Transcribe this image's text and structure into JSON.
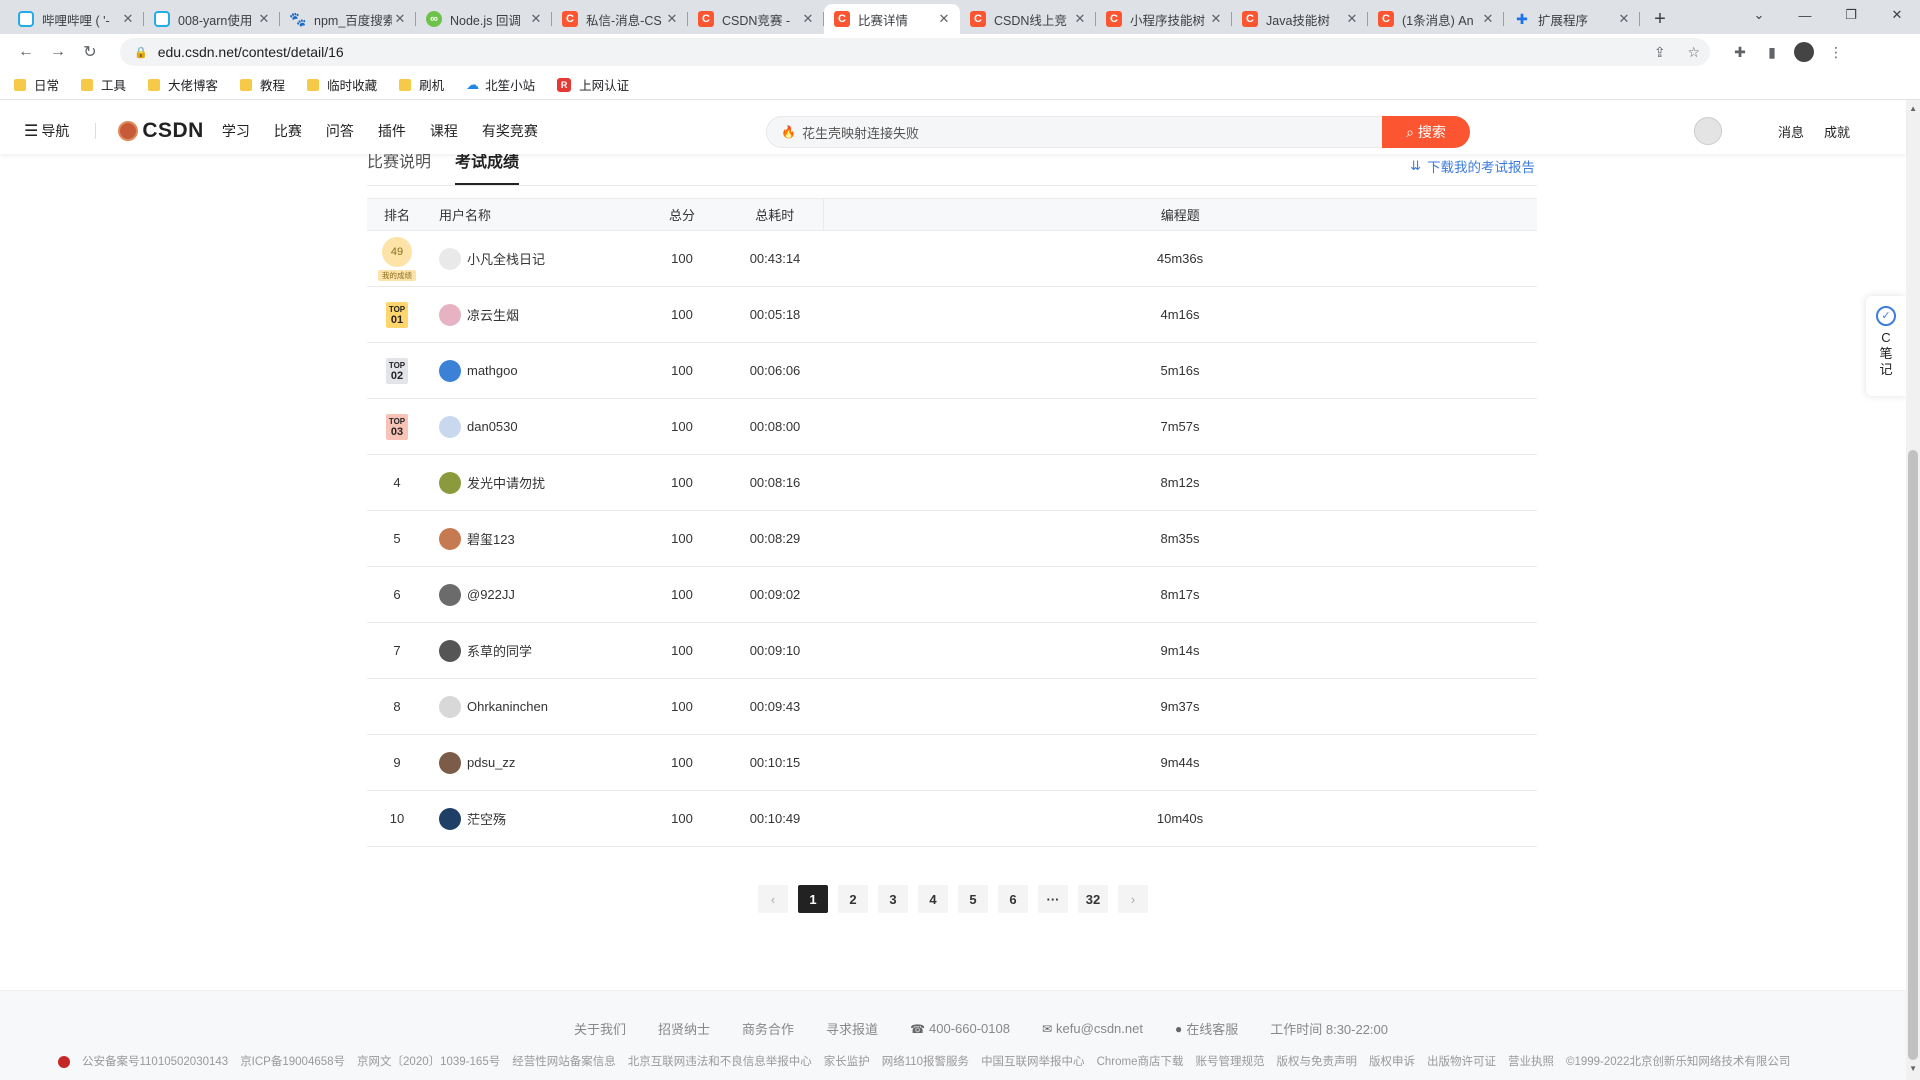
{
  "browser": {
    "tabs": [
      {
        "title": "哔哩哔哩 ( '-",
        "icon": "bili"
      },
      {
        "title": "008-yarn使用",
        "icon": "bili"
      },
      {
        "title": "npm_百度搜索",
        "icon": "paw"
      },
      {
        "title": "Node.js 回调",
        "icon": "node"
      },
      {
        "title": "私信-消息-CS",
        "icon": "csdn"
      },
      {
        "title": "CSDN竞赛 -",
        "icon": "csdn"
      },
      {
        "title": "比赛详情",
        "icon": "csdn"
      },
      {
        "title": "CSDN线上竞",
        "icon": "csdn"
      },
      {
        "title": "小程序技能树",
        "icon": "csdn"
      },
      {
        "title": "Java技能树",
        "icon": "csdn"
      },
      {
        "title": "(1条消息) An",
        "icon": "csdn"
      },
      {
        "title": "扩展程序",
        "icon": "puzzle"
      }
    ],
    "url": "edu.csdn.net/contest/detail/16",
    "bookmarks": [
      "日常",
      "工具",
      "大佬博客",
      "教程",
      "临时收藏",
      "刷机",
      "北笙小站",
      "上网认证"
    ]
  },
  "header": {
    "nav": "导航",
    "logo": "CSDN",
    "links": [
      "学习",
      "比赛",
      "问答",
      "插件",
      "课程",
      "有奖竞赛"
    ],
    "search_placeholder": "花生壳映射连接失败",
    "search_btn": "搜索",
    "messages": "消息",
    "achievements": "成就"
  },
  "content": {
    "tabs": [
      "比赛说明",
      "考试成绩"
    ],
    "active_tab": 1,
    "download": "下载我的考试报告",
    "columns": [
      "排名",
      "用户名称",
      "总分",
      "总耗时",
      "编程题"
    ],
    "mine_label": "我的成绩",
    "top_label": "TOP",
    "rows": [
      {
        "rank": "49",
        "badge": "mine",
        "name": "小凡全栈日记",
        "score": "100",
        "time": "00:43:14",
        "prog": "45m36s",
        "avatar": "#e9e9e9"
      },
      {
        "rank": "01",
        "badge": "gold",
        "name": "凉云生烟",
        "score": "100",
        "time": "00:05:18",
        "prog": "4m16s",
        "avatar": "#e7b3c3"
      },
      {
        "rank": "02",
        "badge": "silver",
        "name": "mathgoo",
        "score": "100",
        "time": "00:06:06",
        "prog": "5m16s",
        "avatar": "#3b82d6"
      },
      {
        "rank": "03",
        "badge": "bronze",
        "name": "dan0530",
        "score": "100",
        "time": "00:08:00",
        "prog": "7m57s",
        "avatar": "#c9d8ef"
      },
      {
        "rank": "4",
        "badge": "none",
        "name": "发光中请勿扰",
        "score": "100",
        "time": "00:08:16",
        "prog": "8m12s",
        "avatar": "#8a9a3c"
      },
      {
        "rank": "5",
        "badge": "none",
        "name": "碧玺123",
        "score": "100",
        "time": "00:08:29",
        "prog": "8m35s",
        "avatar": "#c57a52"
      },
      {
        "rank": "6",
        "badge": "none",
        "name": "@922JJ",
        "score": "100",
        "time": "00:09:02",
        "prog": "8m17s",
        "avatar": "#6b6b6b"
      },
      {
        "rank": "7",
        "badge": "none",
        "name": "系草的同学",
        "score": "100",
        "time": "00:09:10",
        "prog": "9m14s",
        "avatar": "#555555"
      },
      {
        "rank": "8",
        "badge": "none",
        "name": "Ohrkaninchen",
        "score": "100",
        "time": "00:09:43",
        "prog": "9m37s",
        "avatar": "#d8d8d8"
      },
      {
        "rank": "9",
        "badge": "none",
        "name": "pdsu_zz",
        "score": "100",
        "time": "00:10:15",
        "prog": "9m44s",
        "avatar": "#7a5c48"
      },
      {
        "rank": "10",
        "badge": "none",
        "name": "茫空殇",
        "score": "100",
        "time": "00:10:49",
        "prog": "10m40s",
        "avatar": "#1f3f66"
      }
    ]
  },
  "pagination": {
    "prev": "‹",
    "pages": [
      "1",
      "2",
      "3",
      "4",
      "5",
      "6",
      "···",
      "32"
    ],
    "current": "1",
    "next": "›"
  },
  "note_widget": [
    "C",
    "笔",
    "记"
  ],
  "footer": {
    "row1": [
      "关于我们",
      "招贤纳士",
      "商务合作",
      "寻求报道",
      "400-660-0108",
      "kefu@csdn.net",
      "在线客服",
      "工作时间 8:30-22:00"
    ],
    "row2": [
      "公安备案号11010502030143",
      "京ICP备19004658号",
      "京网文〔2020〕1039-165号",
      "经营性网站备案信息",
      "北京互联网违法和不良信息举报中心",
      "家长监护",
      "网络110报警服务",
      "中国互联网举报中心",
      "Chrome商店下载",
      "账号管理规范",
      "版权与免责声明",
      "版权申诉",
      "出版物许可证",
      "营业执照",
      "©1999-2022北京创新乐知网络技术有限公司"
    ]
  }
}
